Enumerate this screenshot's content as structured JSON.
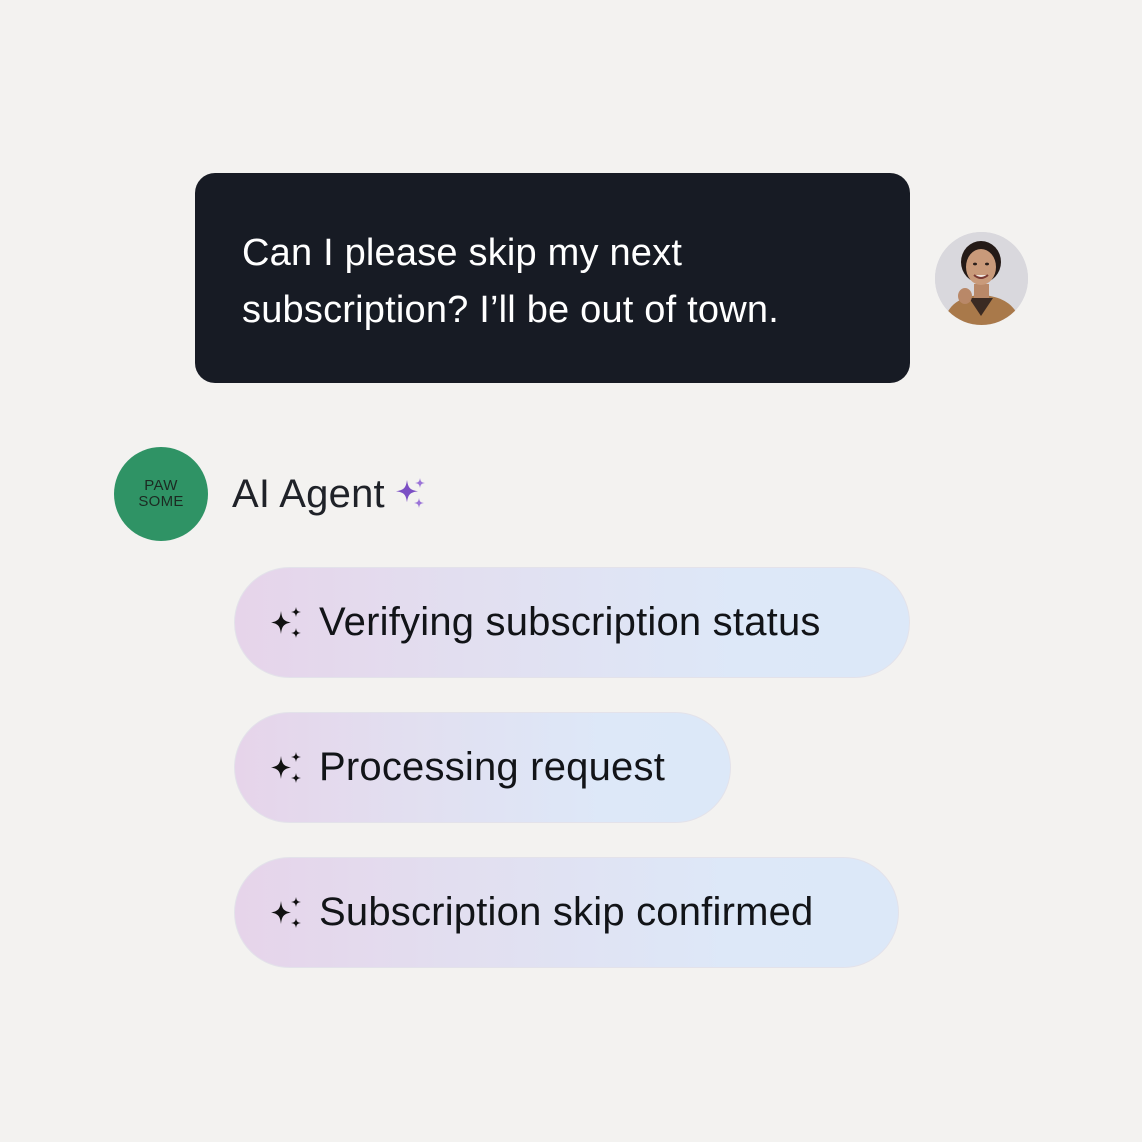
{
  "conversation": {
    "user_message": {
      "lines": [
        "Can I please skip my next",
        "subscription? I’ll be out of town."
      ]
    },
    "agent": {
      "logo_lines": [
        "PAW",
        "SOME"
      ],
      "name": "AI Agent",
      "name_icon": "sparkle-icon",
      "brand_color": "#2f9365"
    },
    "steps": [
      {
        "label": "Verifying subscription status",
        "icon": "sparkle-icon"
      },
      {
        "label": "Processing request",
        "icon": "sparkle-icon"
      },
      {
        "label": "Subscription skip confirmed",
        "icon": "sparkle-icon"
      }
    ]
  },
  "colors": {
    "background": "#f3f2f0",
    "user_bubble": "#171b24",
    "agent_sparkle": "#7b4fc4",
    "pill_gradient_start": "#e6d4ea",
    "pill_gradient_end": "#dce8f8"
  }
}
